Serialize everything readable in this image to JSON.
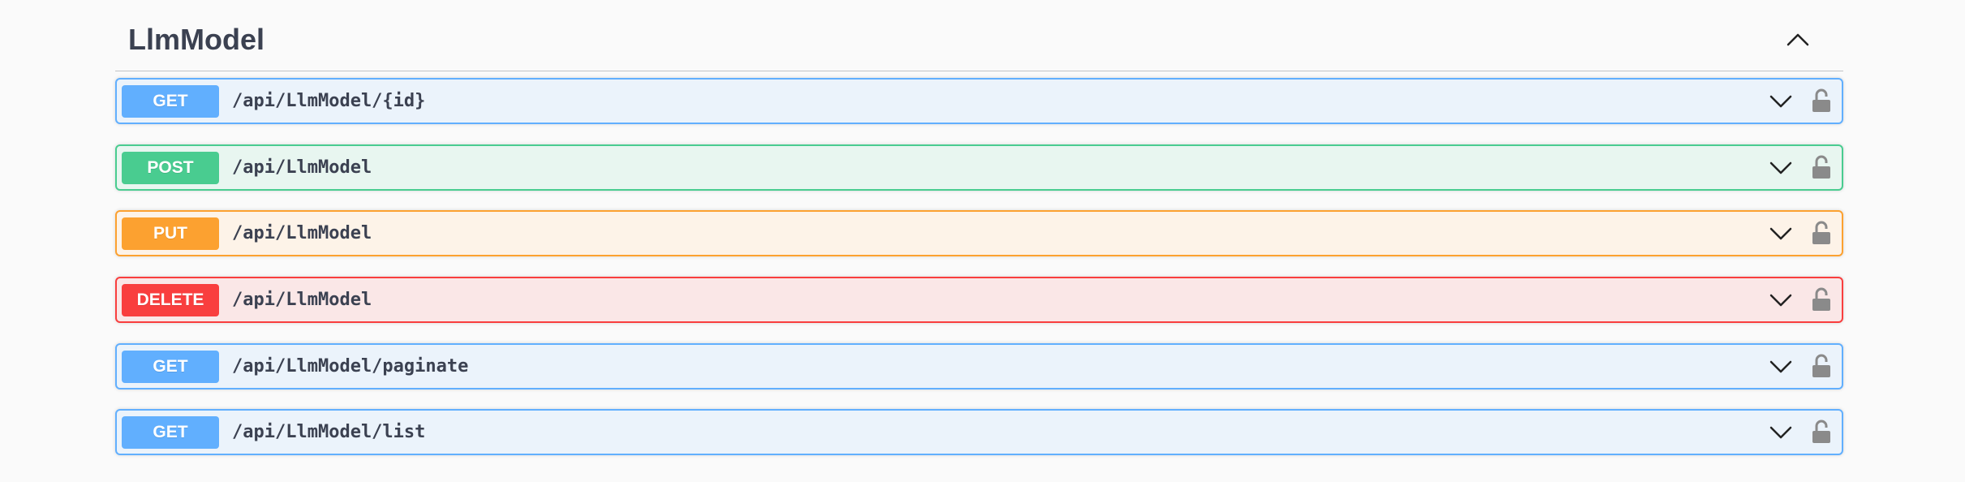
{
  "section": {
    "title": "LlmModel",
    "toggle_icon": "chevron-up-icon"
  },
  "colors": {
    "get": "#61affe",
    "post": "#49cc90",
    "put": "#fca130",
    "delete": "#f93e3e",
    "text": "#3b4151",
    "lock": "#8a8a8a"
  },
  "operations": [
    {
      "method": "GET",
      "path": "/api/LlmModel/{id}",
      "expand_icon": "chevron-down-icon",
      "auth_icon": "lock-icon"
    },
    {
      "method": "POST",
      "path": "/api/LlmModel",
      "expand_icon": "chevron-down-icon",
      "auth_icon": "lock-icon"
    },
    {
      "method": "PUT",
      "path": "/api/LlmModel",
      "expand_icon": "chevron-down-icon",
      "auth_icon": "lock-icon"
    },
    {
      "method": "DELETE",
      "path": "/api/LlmModel",
      "expand_icon": "chevron-down-icon",
      "auth_icon": "lock-icon"
    },
    {
      "method": "GET",
      "path": "/api/LlmModel/paginate",
      "expand_icon": "chevron-down-icon",
      "auth_icon": "lock-icon"
    },
    {
      "method": "GET",
      "path": "/api/LlmModel/list",
      "expand_icon": "chevron-down-icon",
      "auth_icon": "lock-icon"
    }
  ]
}
